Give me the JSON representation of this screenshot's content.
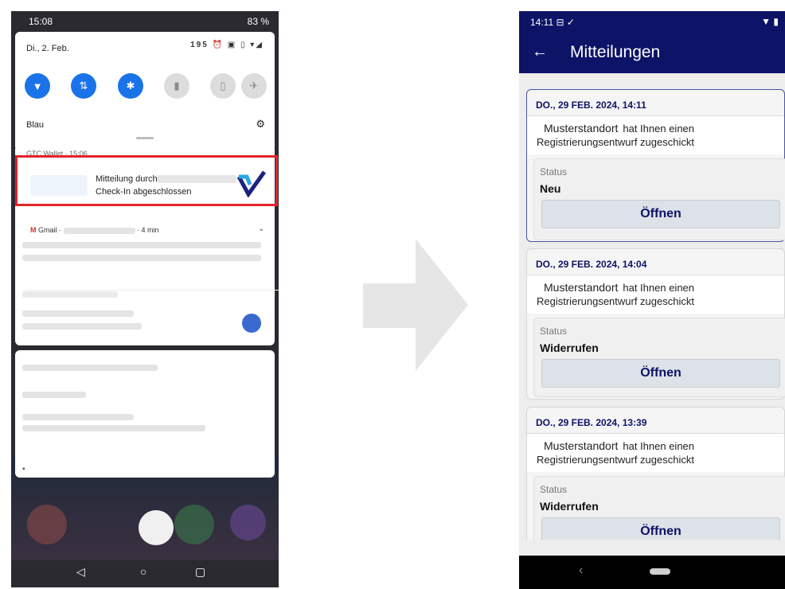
{
  "left_screen": {
    "status_time": "15:08",
    "status_battery": "83 %",
    "date": "Di., 2. Feb.",
    "network_speed": "195",
    "network_blau": "Blau",
    "notification_app_header": "GTC Wallet · 15:06",
    "notification_line1": "Mitteilung durch",
    "notification_line2": "Check-In abgeschlossen",
    "gmail_app": "Gmail ·",
    "gmail_time": "· 4 min",
    "highlight_color": "#e3232b"
  },
  "right_screen": {
    "status_time": "14:11",
    "title": "Mitteilungen",
    "accent_color": "#0d1367",
    "cards": [
      {
        "date": "DO., 29 FEB. 2024, 14:11",
        "sender": "Musterstandort",
        "msg_part1": "hat Ihnen einen",
        "msg_part2": "Registrierungsentwurf zugeschickt",
        "status_label": "Status",
        "status_value": "Neu",
        "button": "Öffnen"
      },
      {
        "date": "DO., 29 FEB. 2024, 14:04",
        "sender": "Musterstandort",
        "msg_part1": "hat Ihnen einen",
        "msg_part2": "Registrierungsentwurf zugeschickt",
        "status_label": "Status",
        "status_value": "Widerrufen",
        "button": "Öffnen"
      },
      {
        "date": "DO., 29 FEB. 2024, 13:39",
        "sender": "Musterstandort",
        "msg_part1": "hat Ihnen einen",
        "msg_part2": "Registrierungsentwurf zugeschickt",
        "status_label": "Status",
        "status_value": "Widerrufen",
        "button": "Öffnen"
      }
    ]
  }
}
